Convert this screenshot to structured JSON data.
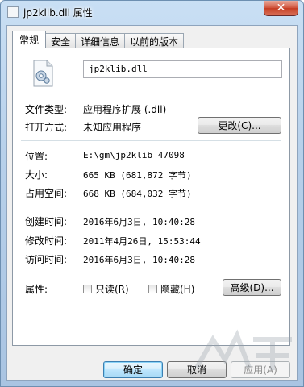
{
  "window": {
    "title": "jp2klib.dll 属性",
    "close_glyph": "✕"
  },
  "tabs": [
    {
      "label": "常规"
    },
    {
      "label": "安全"
    },
    {
      "label": "详细信息"
    },
    {
      "label": "以前的版本"
    }
  ],
  "general": {
    "filename": "jp2klib.dll",
    "file_type_label": "文件类型:",
    "file_type_value": "应用程序扩展 (.dll)",
    "open_with_label": "打开方式:",
    "open_with_value": "未知应用程序",
    "change_button": "更改(C)...",
    "location_label": "位置:",
    "location_value": "E:\\gm\\jp2klib_47098",
    "size_label": "大小:",
    "size_value": "665 KB (681,872 字节)",
    "size_on_disk_label": "占用空间:",
    "size_on_disk_value": "668 KB (684,032 字节)",
    "created_label": "创建时间:",
    "created_value": "2016年6月3日, 10:40:28",
    "modified_label": "修改时间:",
    "modified_value": "2011年4月26日, 15:53:44",
    "accessed_label": "访问时间:",
    "accessed_value": "2016年6月3日, 10:40:28",
    "attributes_label": "属性:",
    "readonly_label": "只读(R)",
    "hidden_label": "隐藏(H)",
    "advanced_button": "高级(D)..."
  },
  "buttons": {
    "ok": "确定",
    "cancel": "取消",
    "apply": "应用(A)"
  },
  "colors": {
    "title_bar": "#b7d0ea",
    "close_button": "#c43c22",
    "default_button_border": "#3c7fb1"
  }
}
